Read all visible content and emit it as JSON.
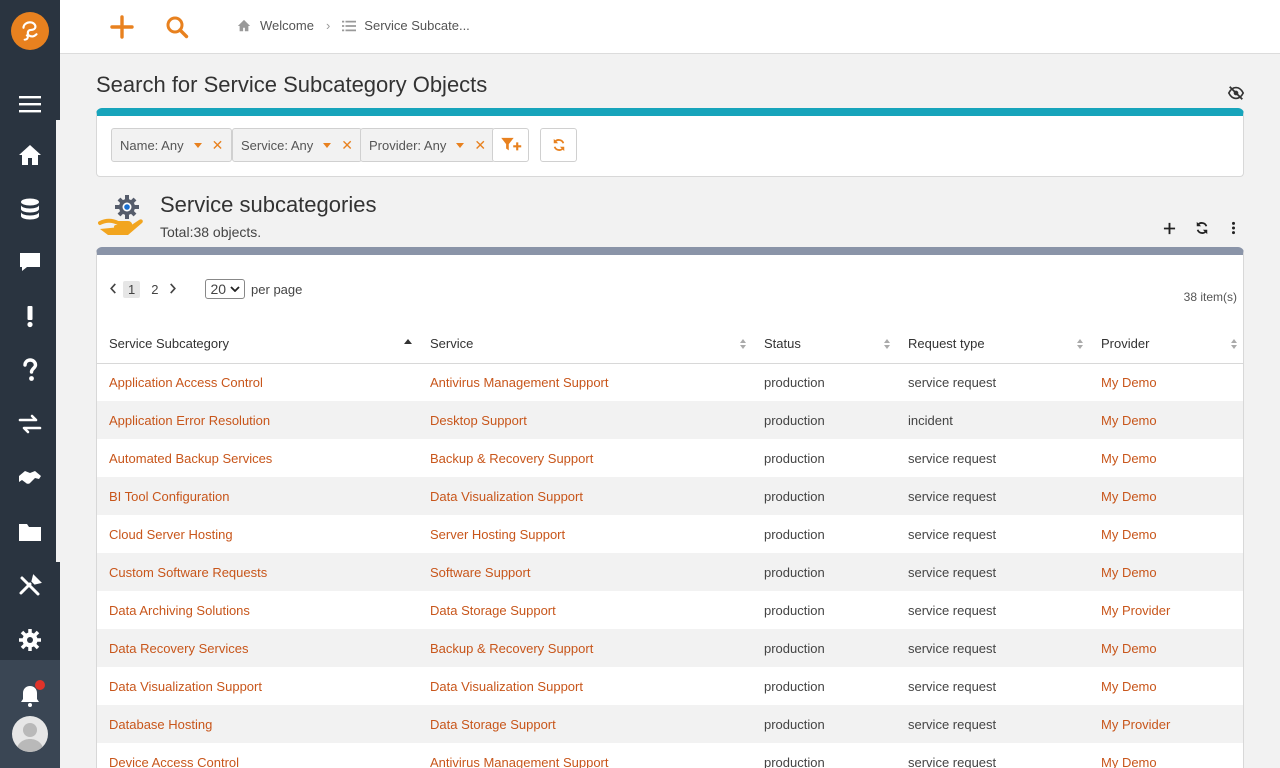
{
  "topbar": {
    "breadcrumb": [
      {
        "label": "Welcome",
        "icon": "home-icon"
      },
      {
        "label": "Service Subcate...",
        "icon": "list-icon"
      }
    ]
  },
  "sidebar": {
    "items": [
      "menu-icon",
      "home-icon",
      "database-icon",
      "comment-icon",
      "exclamation-icon",
      "question-icon",
      "exchange-icon",
      "handshake-icon",
      "folder-icon",
      "tools-icon",
      "gear-icon"
    ]
  },
  "page": {
    "title": "Search for Service Subcategory Objects"
  },
  "filters": [
    {
      "label": "Name: Any"
    },
    {
      "label": "Service: Any"
    },
    {
      "label": "Provider: Any"
    }
  ],
  "section": {
    "title": "Service subcategories",
    "subtitle": "Total:38 objects."
  },
  "pager": {
    "pages": [
      "1",
      "2"
    ],
    "current": "1",
    "per_page": "20",
    "per_page_label": "per page",
    "items_count": "38 item(s)"
  },
  "table": {
    "columns": [
      "Service Subcategory",
      "Service",
      "Status",
      "Request type",
      "Provider"
    ],
    "rows": [
      [
        "Application Access Control",
        "Antivirus Management Support",
        "production",
        "service request",
        "My Demo"
      ],
      [
        "Application Error Resolution",
        "Desktop Support",
        "production",
        "incident",
        "My Demo"
      ],
      [
        "Automated Backup Services",
        "Backup & Recovery Support",
        "production",
        "service request",
        "My Demo"
      ],
      [
        "BI Tool Configuration",
        "Data Visualization Support",
        "production",
        "service request",
        "My Demo"
      ],
      [
        "Cloud Server Hosting",
        "Server Hosting Support",
        "production",
        "service request",
        "My Demo"
      ],
      [
        "Custom Software Requests",
        "Software Support",
        "production",
        "service request",
        "My Demo"
      ],
      [
        "Data Archiving Solutions",
        "Data Storage Support",
        "production",
        "service request",
        "My Provider"
      ],
      [
        "Data Recovery Services",
        "Backup & Recovery Support",
        "production",
        "service request",
        "My Demo"
      ],
      [
        "Data Visualization Support",
        "Data Visualization Support",
        "production",
        "service request",
        "My Demo"
      ],
      [
        "Database Hosting",
        "Data Storage Support",
        "production",
        "service request",
        "My Provider"
      ],
      [
        "Device Access Control",
        "Antivirus Management Support",
        "production",
        "service request",
        "My Demo"
      ]
    ]
  },
  "colors": {
    "accent": "#e8811f",
    "link": "#c8561b",
    "sidebar": "#2a3440",
    "search_bar": "#17a4bb"
  }
}
